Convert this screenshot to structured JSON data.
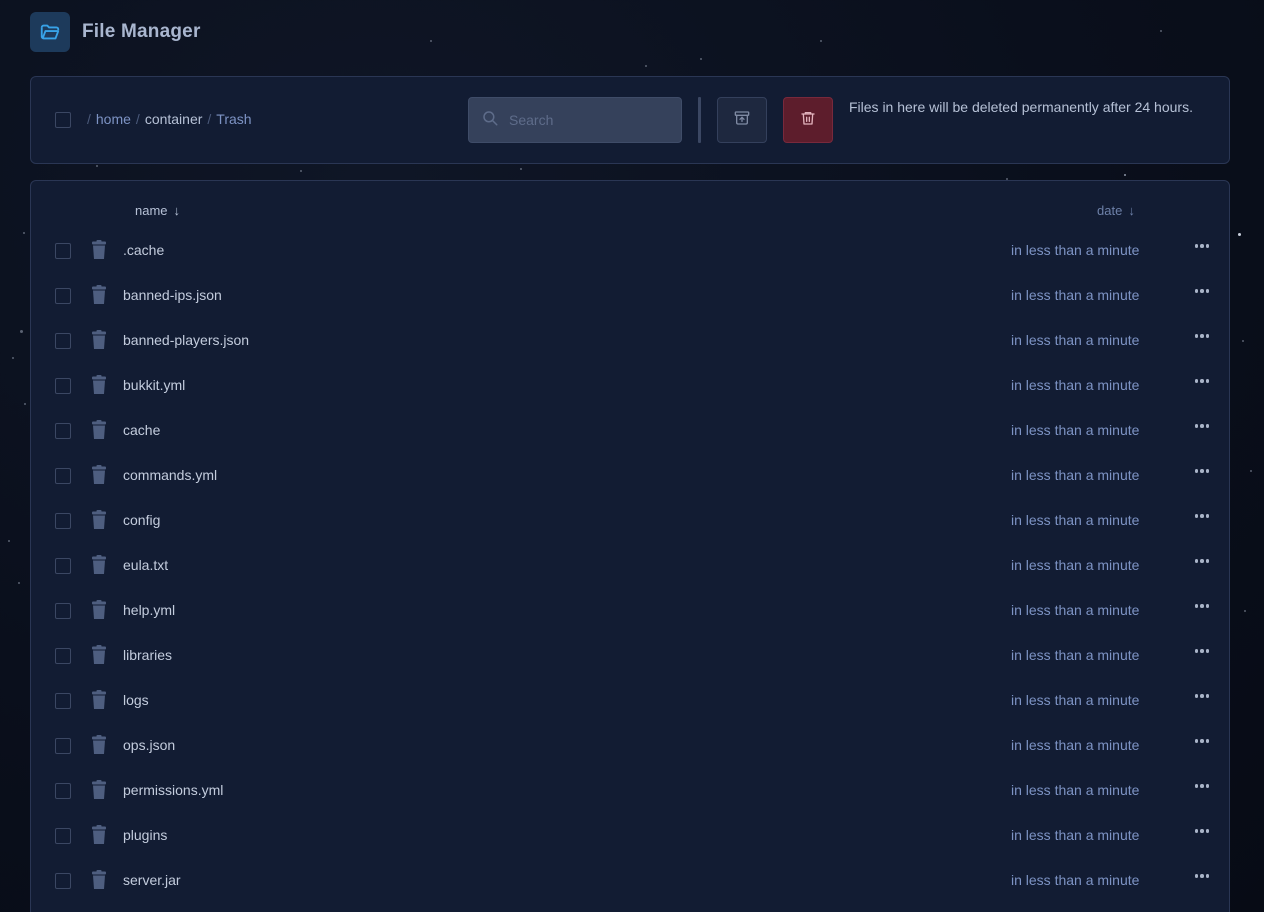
{
  "app": {
    "title": "File Manager"
  },
  "toolbar": {
    "breadcrumb": [
      {
        "label": "home",
        "current": false
      },
      {
        "label": "container",
        "current": true
      },
      {
        "label": "Trash",
        "current": false
      }
    ],
    "search_placeholder": "Search",
    "notice": "Files in here will be deleted permanently after 24 hours."
  },
  "columns": {
    "name": "name",
    "name_sort": "↓",
    "date": "date",
    "date_sort": "↓"
  },
  "files": [
    {
      "name": ".cache",
      "date": "in less than a minute"
    },
    {
      "name": "banned-ips.json",
      "date": "in less than a minute"
    },
    {
      "name": "banned-players.json",
      "date": "in less than a minute"
    },
    {
      "name": "bukkit.yml",
      "date": "in less than a minute"
    },
    {
      "name": "cache",
      "date": "in less than a minute"
    },
    {
      "name": "commands.yml",
      "date": "in less than a minute"
    },
    {
      "name": "config",
      "date": "in less than a minute"
    },
    {
      "name": "eula.txt",
      "date": "in less than a minute"
    },
    {
      "name": "help.yml",
      "date": "in less than a minute"
    },
    {
      "name": "libraries",
      "date": "in less than a minute"
    },
    {
      "name": "logs",
      "date": "in less than a minute"
    },
    {
      "name": "ops.json",
      "date": "in less than a minute"
    },
    {
      "name": "permissions.yml",
      "date": "in less than a minute"
    },
    {
      "name": "plugins",
      "date": "in less than a minute"
    },
    {
      "name": "server.jar",
      "date": "in less than a minute"
    }
  ],
  "icons": {
    "app": "folder-icon",
    "search": "search-icon",
    "restore": "archive-restore-icon",
    "delete": "trash-icon",
    "file": "trash-icon",
    "more": "more-horizontal-icon"
  },
  "colors": {
    "accent": "#38a3e8",
    "danger": "#5d1d2c",
    "link": "#7d93c4"
  }
}
